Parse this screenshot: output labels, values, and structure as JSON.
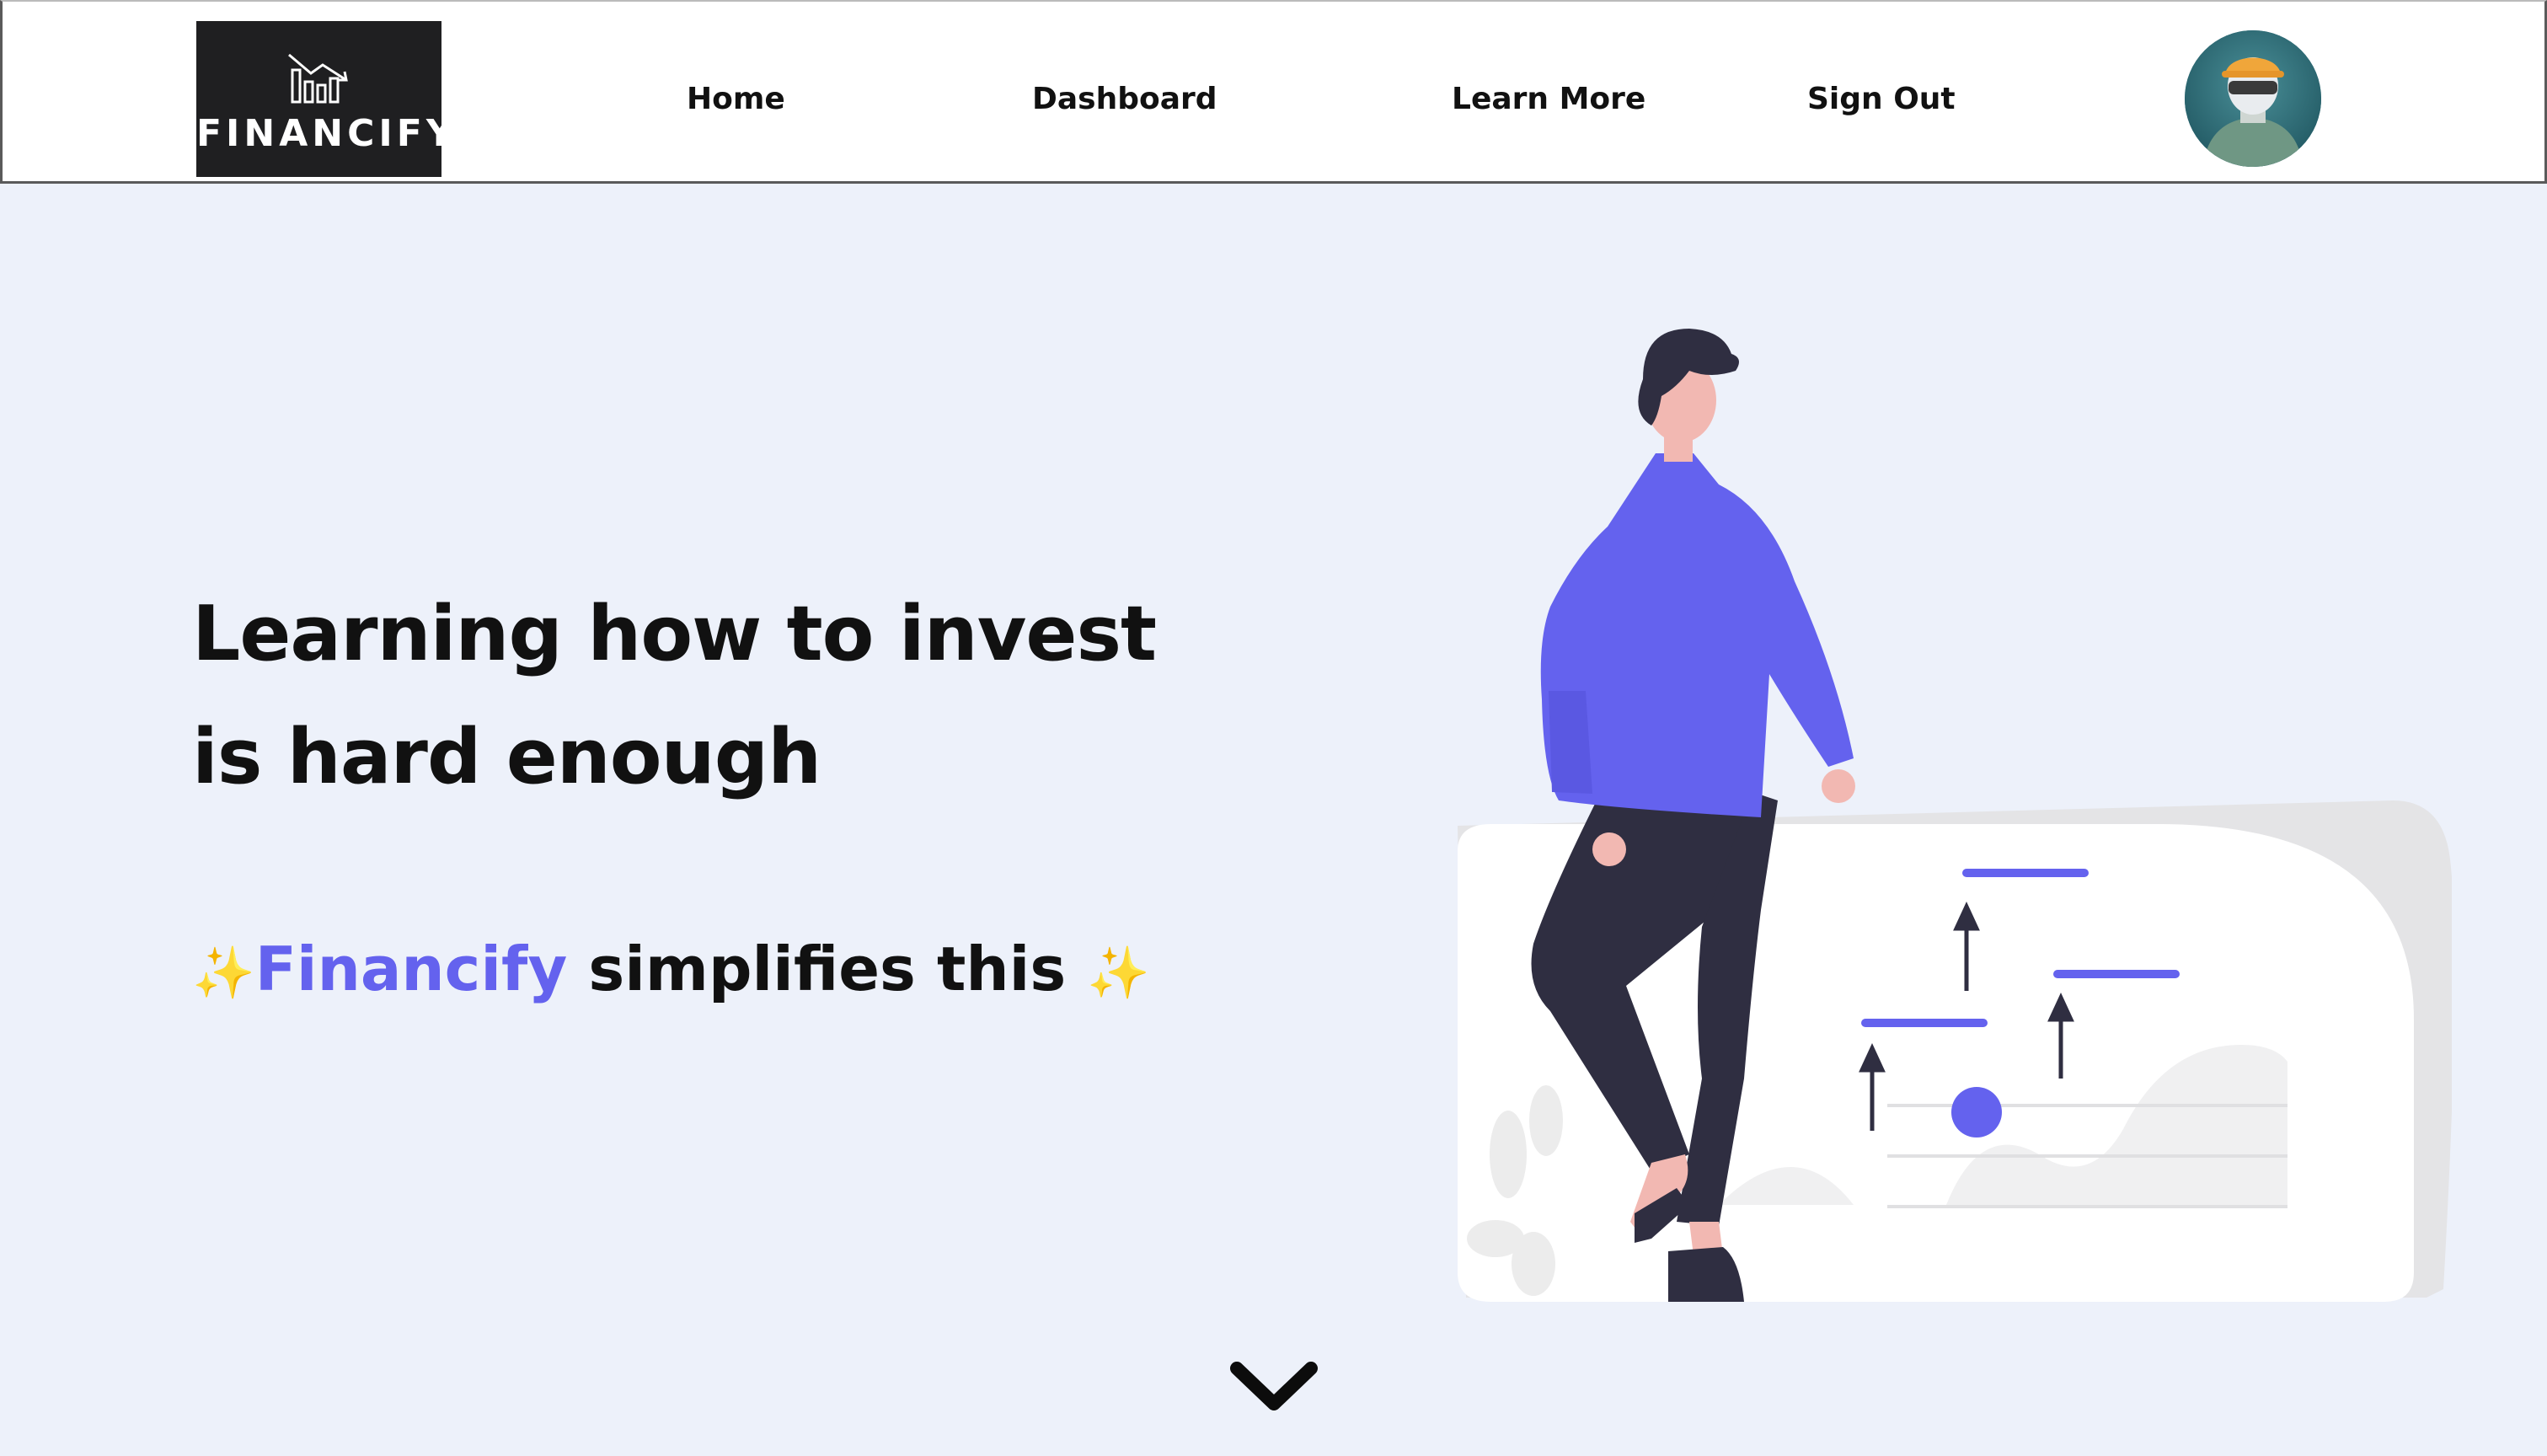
{
  "header": {
    "logo_text": "FINANCIFY",
    "nav": {
      "home": "Home",
      "dashboard": "Dashboard",
      "learn_more": "Learn More",
      "sign_out": "Sign Out"
    }
  },
  "hero": {
    "title_line1": "Learning how to invest",
    "title_line2": "is hard enough",
    "tagline": {
      "sparkle_left": "✨",
      "brand": "Financify",
      "rest": " simplifies this ",
      "sparkle_right": "✨"
    }
  },
  "icons": {
    "logo": "bar-chart-trend-down-icon",
    "avatar": "user-avatar",
    "scroll": "chevron-down-icon"
  },
  "colors": {
    "background": "#edf1fa",
    "accent": "#6462ee",
    "text": "#111111",
    "logo_bg": "#1f1f21"
  }
}
